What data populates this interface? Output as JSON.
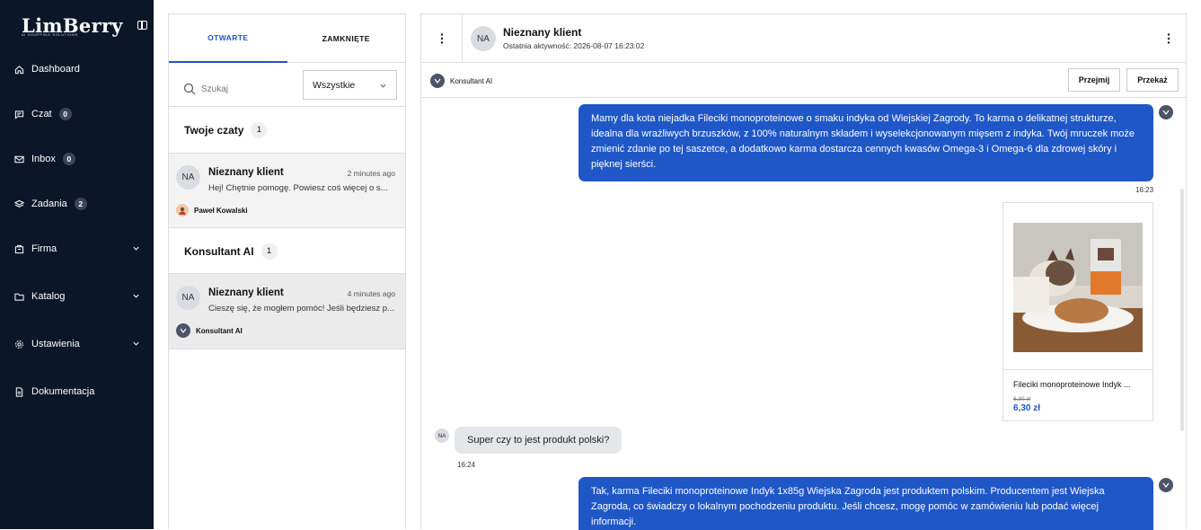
{
  "brand": {
    "name": "LimBerry",
    "tagline": "AI SHOPPING SOLUTIONS"
  },
  "sidebar": {
    "items": [
      {
        "label": "Dashboard",
        "icon": "home-icon"
      },
      {
        "label": "Czat",
        "icon": "chat-icon",
        "badge": "0"
      },
      {
        "label": "Inbox",
        "icon": "mail-icon",
        "badge": "0"
      },
      {
        "label": "Zadania",
        "icon": "layers-icon",
        "badge": "2"
      },
      {
        "label": "Firma",
        "icon": "building-icon"
      },
      {
        "label": "Katalog",
        "icon": "folder-icon"
      },
      {
        "label": "Ustawienia",
        "icon": "gear-icon"
      },
      {
        "label": "Dokumentacja",
        "icon": "document-icon"
      }
    ]
  },
  "list": {
    "tabs": [
      "OTWARTE",
      "ZAMKNIĘTE"
    ],
    "search_placeholder": "Szukaj",
    "filter": "Wszystkie",
    "sections": [
      {
        "title": "Twoje czaty",
        "count": "1",
        "conv": {
          "initials": "NA",
          "name": "Nieznany klient",
          "time": "2 minutes ago",
          "preview": "Hej! Chętnie pomogę. Powiesz coś więcej o s...",
          "owner": "Paweł Kowalski"
        }
      },
      {
        "title": "Konsultant AI",
        "count": "1",
        "conv": {
          "initials": "NA",
          "name": "Nieznany klient",
          "time": "4 minutes ago",
          "preview": "Cieszę się, że mogłem pomóc! Jeśli będziesz p...",
          "owner": "Konsultant AI"
        }
      }
    ]
  },
  "chat": {
    "initials": "NA",
    "name": "Nieznany klient",
    "last_activity": "Ostatnia aktywność: 2026-08-07 16:23:02",
    "agent": "Konsultant AI",
    "btn_take": "Przejmij",
    "btn_transfer": "Przekaż",
    "messages": {
      "m1": "Mamy dla kota niejadka Fileciki monoproteinowe o smaku indyka od Wiejskiej Zagrody. To karma o delikatnej strukturze, idealna dla wrażliwych brzuszków, z 100% naturalnym składem i wyselekcjonowanym mięsem z indyka. Twój mruczek może zmienić zdanie po tej saszetce, a dodatkowo karma dostarcza cennych kwasów Omega-3 i Omega-6 dla zdrowej skóry i pięknej sierści.",
      "m1_time": "16:23",
      "product": {
        "name": "Fileciki monoproteinowe Indyk ...",
        "old_price": "6,30 zł",
        "price": "6,30 zł"
      },
      "m2": "Super czy to jest produkt polski?",
      "m2_initials": "NA",
      "m2_time": "16:24",
      "m3": "Tak, karma Fileciki monoproteinowe Indyk 1x85g Wiejska Zagroda jest produktem polskim. Producentem jest Wiejska Zagroda, co świadczy o lokalnym pochodzeniu produktu. Jeśli chcesz, mogę pomóc w zamówieniu lub podać więcej informacji."
    }
  }
}
